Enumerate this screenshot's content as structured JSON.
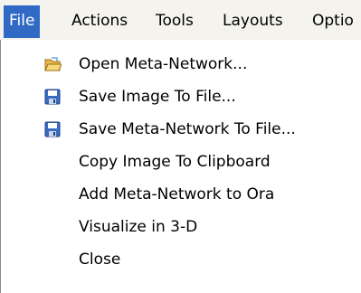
{
  "menubar": {
    "items": [
      {
        "label": "File",
        "active": true
      },
      {
        "label": "Actions",
        "active": false
      },
      {
        "label": "Tools",
        "active": false
      },
      {
        "label": "Layouts",
        "active": false
      },
      {
        "label": "Optio",
        "active": false
      }
    ]
  },
  "file_menu": {
    "items": [
      {
        "label": "Open Meta-Network...",
        "icon": "open-folder-icon"
      },
      {
        "label": "Save Image To File...",
        "icon": "save-disk-icon"
      },
      {
        "label": "Save Meta-Network To File...",
        "icon": "save-disk-icon"
      },
      {
        "label": "Copy Image To Clipboard",
        "icon": ""
      },
      {
        "label": "Add Meta-Network to Ora",
        "icon": ""
      },
      {
        "label": "Visualize in 3-D",
        "icon": ""
      },
      {
        "label": "Close",
        "icon": ""
      }
    ]
  },
  "colors": {
    "menubar_bg": "#f4f3ee",
    "active_bg": "#316ac5",
    "active_text": "#ffffff",
    "menu_bg": "#ffffff"
  }
}
